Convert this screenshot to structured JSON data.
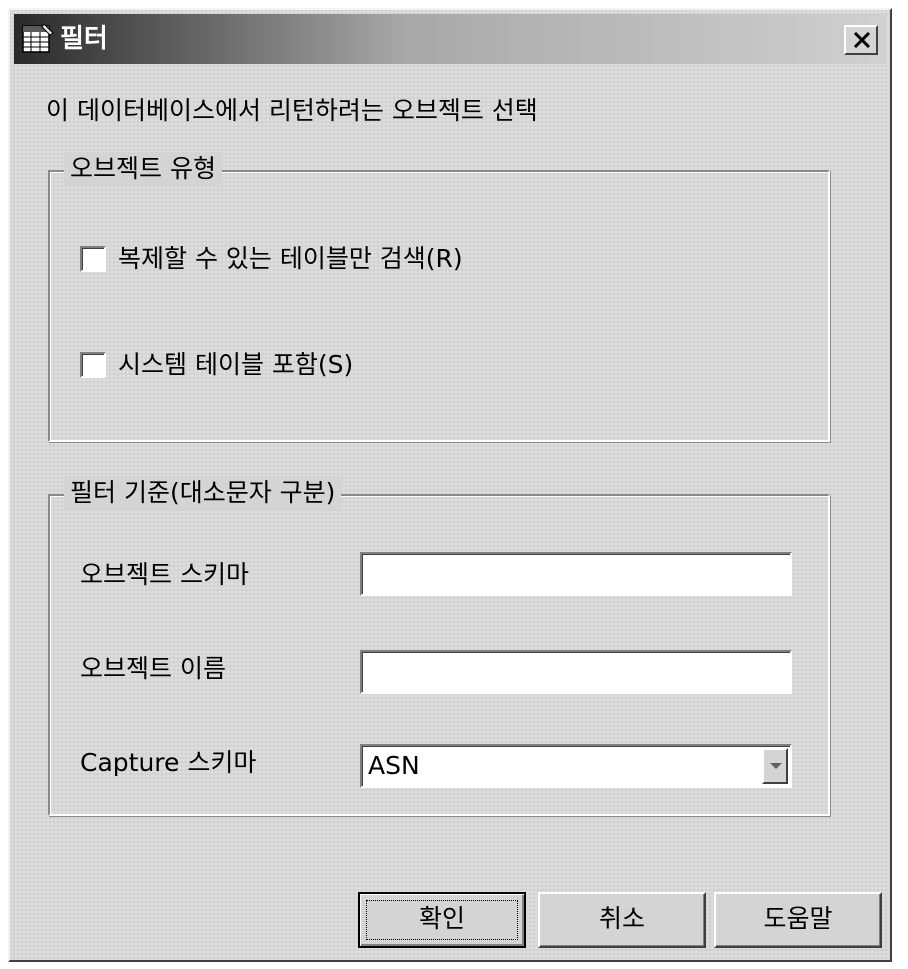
{
  "window": {
    "title": "필터",
    "title_icon": "table-grid-icon",
    "close_icon": "close-icon"
  },
  "instruction": "이 데이터베이스에서 리턴하려는 오브젝트 선택",
  "object_type_group": {
    "legend": "오브젝트 유형",
    "checkboxes": [
      {
        "label": "복제할 수 있는 테이블만 검색(R)",
        "checked": false
      },
      {
        "label": "시스템 테이블 포함(S)",
        "checked": false
      }
    ]
  },
  "filter_group": {
    "legend": "필터 기준(대소문자 구분)",
    "object_schema_label": "오브젝트 스키마",
    "object_schema_value": "",
    "object_name_label": "오브젝트 이름",
    "object_name_value": "",
    "capture_schema_label": "Capture 스키마",
    "capture_schema_value": "ASN"
  },
  "buttons": {
    "ok": "확인",
    "cancel": "취소",
    "help": "도움말"
  },
  "colors": {
    "dialog_bg": "#d4d4d4",
    "title_gradient_start": "#2a2a2a",
    "title_gradient_end": "#d0d0d0"
  }
}
